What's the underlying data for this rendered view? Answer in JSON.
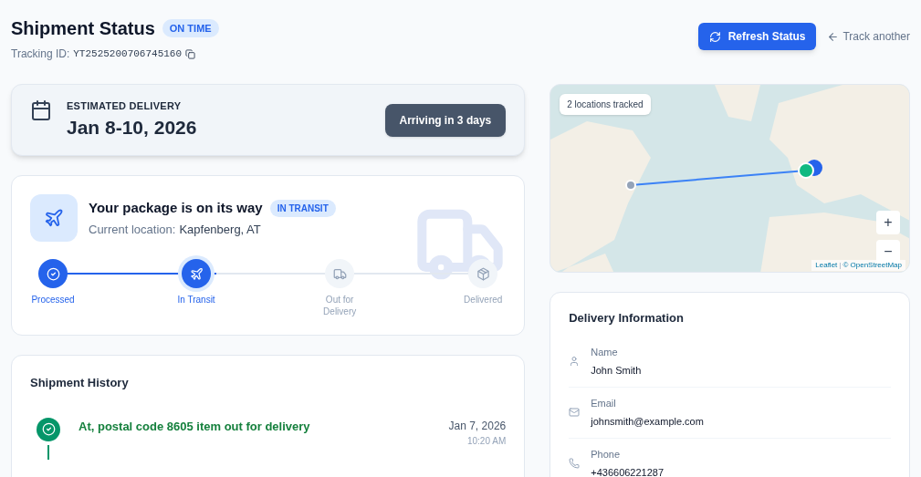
{
  "header": {
    "title": "Shipment Status",
    "status_badge": "ON TIME",
    "tracking_label": "Tracking ID:",
    "tracking_id": "YT2525200706745160"
  },
  "actions": {
    "refresh": "Refresh Status",
    "track_another": "Track another"
  },
  "estimate": {
    "label": "ESTIMATED DELIVERY",
    "dates": "Jan 8-10, 2026",
    "arriving": "Arriving in 3 days"
  },
  "status": {
    "title": "Your package is on its way",
    "badge": "IN TRANSIT",
    "location_label": "Current location:",
    "location": "Kapfenberg, AT",
    "steps": [
      {
        "label": "Processed",
        "done": true,
        "selected": false,
        "kind": "check"
      },
      {
        "label": "In Transit",
        "done": true,
        "selected": true,
        "kind": "plane"
      },
      {
        "label": "Out for Delivery",
        "done": false,
        "selected": false,
        "kind": "truck"
      },
      {
        "label": "Delivered",
        "done": false,
        "selected": false,
        "kind": "box"
      }
    ],
    "level": 0.38
  },
  "history": {
    "title": "Shipment History",
    "events": [
      {
        "text": "At, postal code 8605 item out for delivery",
        "date": "Jan 7, 2026",
        "time": "10:20 AM"
      }
    ]
  },
  "map": {
    "tracked": "2 locations tracked",
    "zoom_in": "+",
    "zoom_out": "−",
    "attribution_link": "Leaflet",
    "attribution_sep": "|",
    "attribution": "© OpenStreetMap"
  },
  "delivery": {
    "title": "Delivery Information",
    "fields": [
      {
        "kind": "person",
        "label": "Name",
        "value": "John Smith"
      },
      {
        "kind": "email",
        "label": "Email",
        "value": "johnsmith@example.com"
      },
      {
        "kind": "phone",
        "label": "Phone",
        "value": "+436606221287"
      }
    ]
  }
}
